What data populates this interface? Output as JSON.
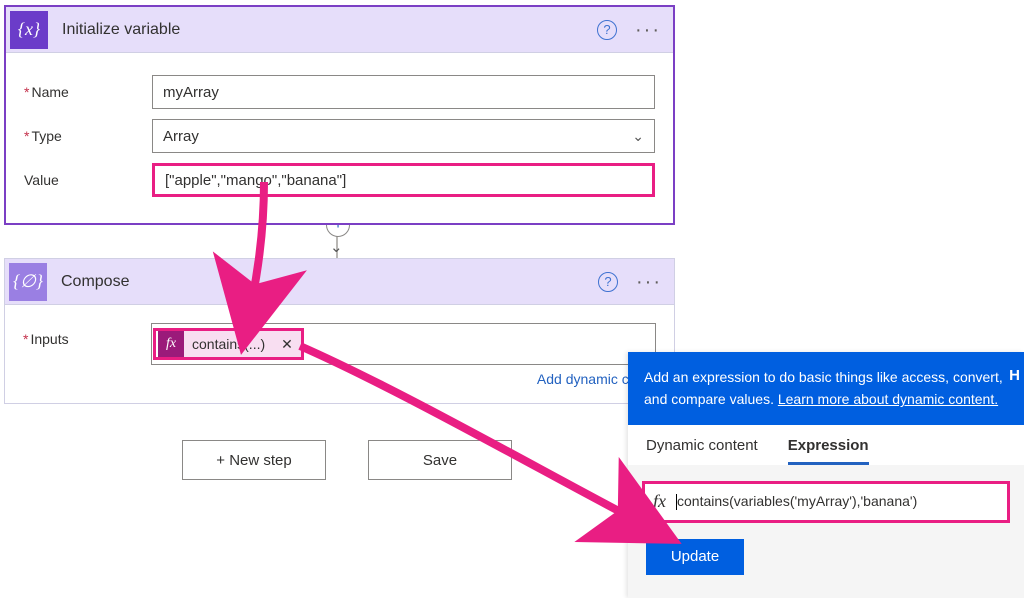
{
  "card1": {
    "title": "Initialize variable",
    "name_label": "Name",
    "name_value": "myArray",
    "type_label": "Type",
    "type_value": "Array",
    "value_label": "Value",
    "value_value": "[\"apple\",\"mango\",\"banana\"]"
  },
  "card2": {
    "title": "Compose",
    "inputs_label": "Inputs",
    "token_label": "contains(...)",
    "dyn_link": "Add dynamic conte"
  },
  "buttons": {
    "new_step": "+ New step",
    "save": "Save"
  },
  "expr": {
    "blurb_a": "Add an expression to do basic things like access, convert, and compare values. ",
    "blurb_link": "Learn more about dynamic content.",
    "tab_dc": "Dynamic content",
    "tab_ex": "Expression",
    "fx": "fx",
    "expression": "contains(variables('myArray'),'banana')",
    "update": "Update"
  },
  "glyphs": {
    "var_icon": "{x}",
    "compose_icon": "{∅}",
    "fx_icon": "fx",
    "help": "?",
    "more": "···",
    "chev": "⌄",
    "plus": "+",
    "close": "✕",
    "down": "⌄"
  },
  "cutoff": "H"
}
